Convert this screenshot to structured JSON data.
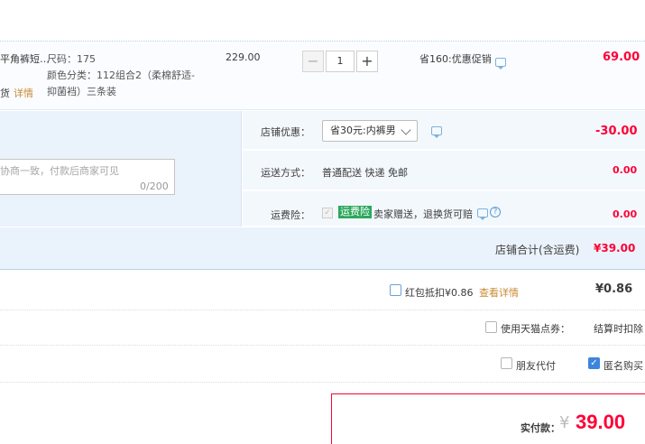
{
  "item": {
    "name_partial": "平角裤短…",
    "status_partial": "货",
    "detail_link": "详情",
    "sku_size": "尺码：175",
    "sku_color_line1": "颜色分类：112组合2（柔棉舒适-",
    "sku_color_line2": "抑菌裆）三条装",
    "unit_price": "229.00",
    "qty_minus": "−",
    "quantity": "1",
    "qty_plus": "+",
    "promo": "省160:优惠促销",
    "total": "69.00"
  },
  "message": {
    "placeholder": "协商一致，付款后商家可见",
    "count": "0/200"
  },
  "shop_coupon": {
    "label": "店铺优惠：",
    "selected": "省30元:内裤男",
    "value": "-30.00"
  },
  "shipping": {
    "label": "运送方式：",
    "text": "普通配送 快递 免邮",
    "value": "0.00"
  },
  "insurance": {
    "label": "运费险：",
    "check": "✓",
    "badge": "运费险",
    "text": "卖家赠送，退换货可赔",
    "help": "?",
    "value": "0.00"
  },
  "shop_total": {
    "label": "店铺合计(含运费)",
    "value": "¥39.00"
  },
  "redpacket": {
    "text": "红包抵扣¥0.86",
    "link": "查看详情",
    "value": "¥0.86"
  },
  "tmall_points": {
    "text": "使用天猫点券：",
    "settle": "结算时扣除"
  },
  "friend_pay": {
    "text": "朋友代付"
  },
  "anonymous": {
    "text": "匿名购买",
    "check": "✓"
  },
  "payment": {
    "label": "实付款：",
    "currency": "¥",
    "amount": "39.00"
  },
  "colors": {
    "accent_red": "#ff0036",
    "panel_blue": "#eaf3fc",
    "link_orange": "#c88a34",
    "insurance_green": "#2aa85b"
  }
}
